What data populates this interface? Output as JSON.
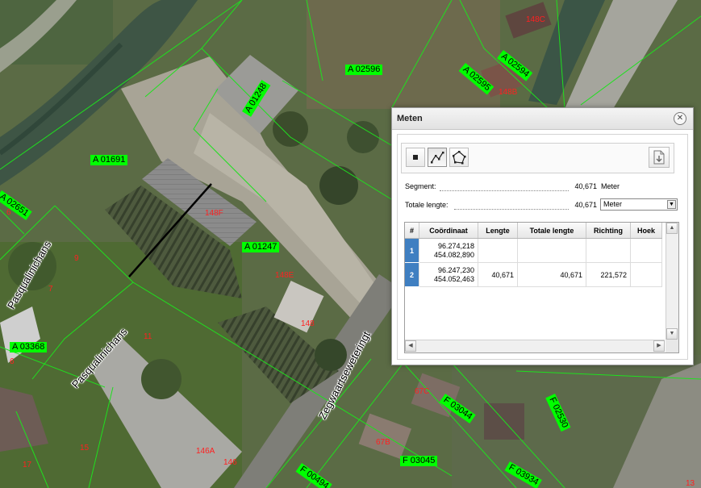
{
  "map": {
    "parcels": [
      {
        "text": "A 02596"
      },
      {
        "text": "A 02594"
      },
      {
        "text": "A 02595"
      },
      {
        "text": "A 01248"
      },
      {
        "text": "A 01691"
      },
      {
        "text": "A 02651"
      },
      {
        "text": "A 01247"
      },
      {
        "text": "A 03368"
      },
      {
        "text": "F 03044"
      },
      {
        "text": "F 02530"
      },
      {
        "text": "F 03045"
      },
      {
        "text": "F 03934"
      },
      {
        "text": "F 00494"
      }
    ],
    "house_numbers": [
      "148C",
      "148B",
      "148F",
      "148E",
      "148",
      "146A",
      "146",
      "67C",
      "67B",
      "15",
      "17",
      "9",
      "7",
      "11",
      "6",
      "6",
      "13"
    ],
    "streets": [
      "Pasqualinichans",
      "Pasqualinichans",
      "Zegwaartseweteringt"
    ]
  },
  "dialog": {
    "title": "Meten",
    "close_icon": "close-icon",
    "tools": [
      {
        "name": "point-tool",
        "icon": "point-icon"
      },
      {
        "name": "line-tool",
        "icon": "polyline-icon",
        "active": true
      },
      {
        "name": "polygon-tool",
        "icon": "polygon-icon"
      }
    ],
    "export_icon": "export-document-icon",
    "segment": {
      "label": "Segment:",
      "value": "40,671",
      "unit": "Meter"
    },
    "total": {
      "label": "Totale lengte:",
      "value": "40,671",
      "unit_selected": "Meter"
    },
    "table": {
      "columns": [
        "#",
        "Coördinaat",
        "Lengte",
        "Totale lengte",
        "Richting",
        "Hoek"
      ],
      "rows": [
        {
          "n": "1",
          "coord1": "96.274,218",
          "coord2": "454.082,890",
          "lengte": "",
          "totaal": "",
          "richting": "",
          "hoek": ""
        },
        {
          "n": "2",
          "coord1": "96.247,230",
          "coord2": "454.052,463",
          "lengte": "40,671",
          "totaal": "40,671",
          "richting": "221,572",
          "hoek": ""
        }
      ]
    },
    "accent_color": "#3f7fc1"
  }
}
